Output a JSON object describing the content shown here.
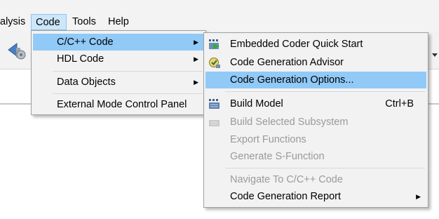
{
  "menubar": {
    "items": [
      {
        "label": "alysis"
      },
      {
        "label": "Code"
      },
      {
        "label": "Tools"
      },
      {
        "label": "Help"
      }
    ]
  },
  "code_menu": {
    "items": [
      {
        "label": "C/C++ Code",
        "submenu": true
      },
      {
        "label": "HDL Code",
        "submenu": true
      },
      {
        "label": "Data Objects",
        "submenu": true
      },
      {
        "label": "External Mode Control Panel",
        "submenu": false
      }
    ]
  },
  "cpp_submenu": {
    "items": [
      {
        "label": "Embedded Coder Quick Start",
        "icon": "quick-start-icon",
        "enabled": true
      },
      {
        "label": "Code Generation Advisor",
        "icon": "advisor-icon",
        "enabled": true
      },
      {
        "label": "Code Generation Options...",
        "icon": "",
        "enabled": true
      },
      {
        "label": "Build Model",
        "accel": "Ctrl+B",
        "icon": "build-icon",
        "enabled": true
      },
      {
        "label": "Build Selected Subsystem",
        "icon": "build-subsystem-icon",
        "enabled": false
      },
      {
        "label": "Export Functions",
        "enabled": false
      },
      {
        "label": "Generate S-Function",
        "enabled": false
      },
      {
        "label": "Navigate To C/C++ Code",
        "enabled": false
      },
      {
        "label": "Code Generation Report",
        "submenu": true,
        "enabled": true
      }
    ]
  },
  "colors": {
    "highlight": "#91c9f7",
    "open_menu": "#cce6fa",
    "disabled_text": "#9a9a9a"
  }
}
